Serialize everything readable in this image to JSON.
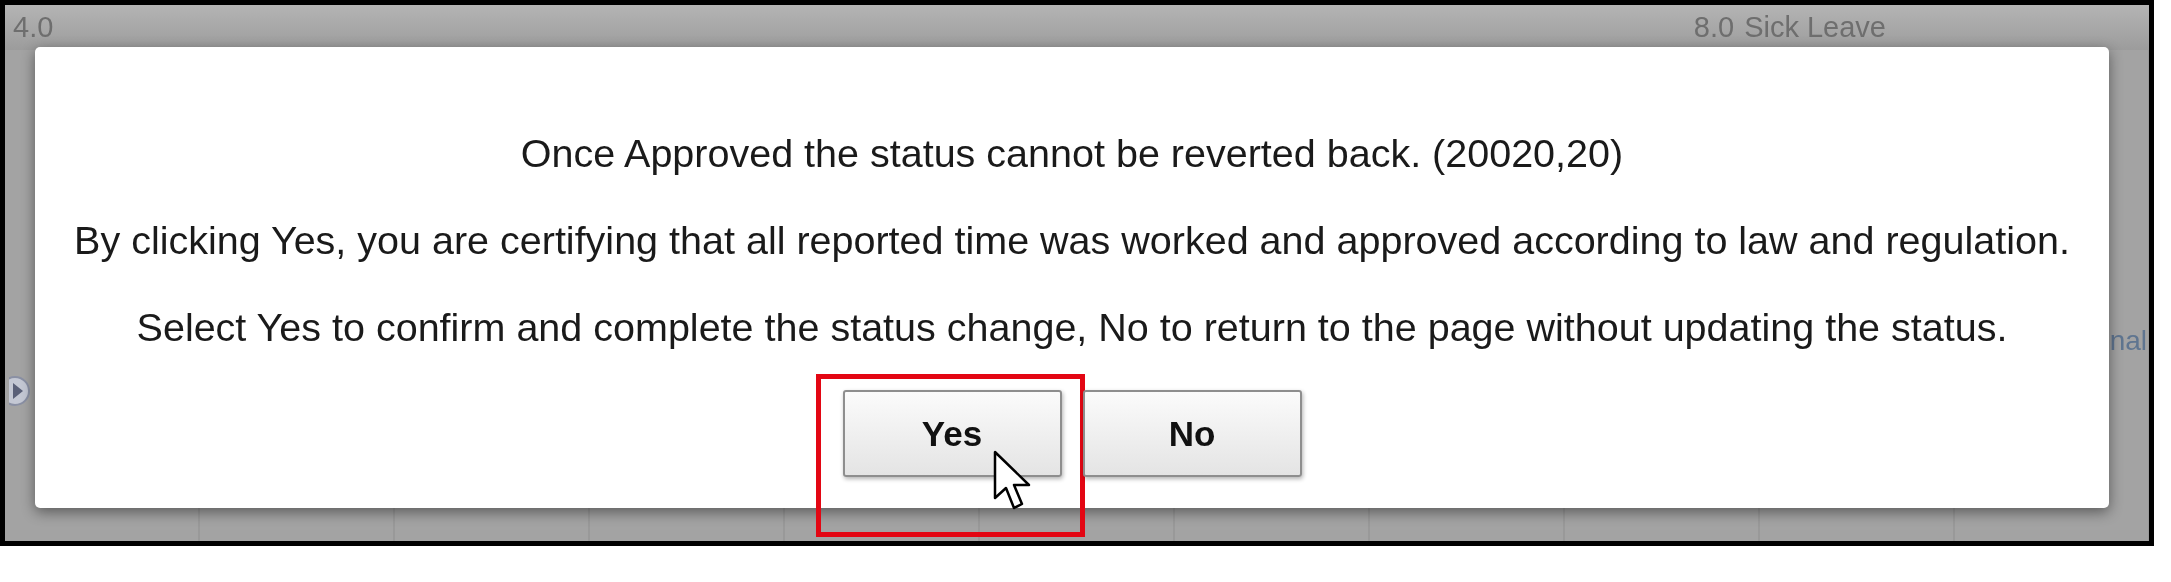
{
  "background": {
    "cells": [
      {
        "text": "4.0"
      },
      {
        "text": "8.0"
      },
      {
        "text": "Sick Leave"
      },
      {
        "text": "nal"
      }
    ]
  },
  "dialog": {
    "messages": [
      "Once Approved the status cannot be reverted back. (20020,20)",
      "By clicking Yes, you are certifying that all reported time was worked and approved according to law and regulation.",
      "Select Yes to confirm and complete the status change, No to return to the page without updating the status."
    ],
    "buttons": [
      {
        "label": "Yes",
        "highlighted": true
      },
      {
        "label": "No",
        "highlighted": false
      }
    ]
  }
}
